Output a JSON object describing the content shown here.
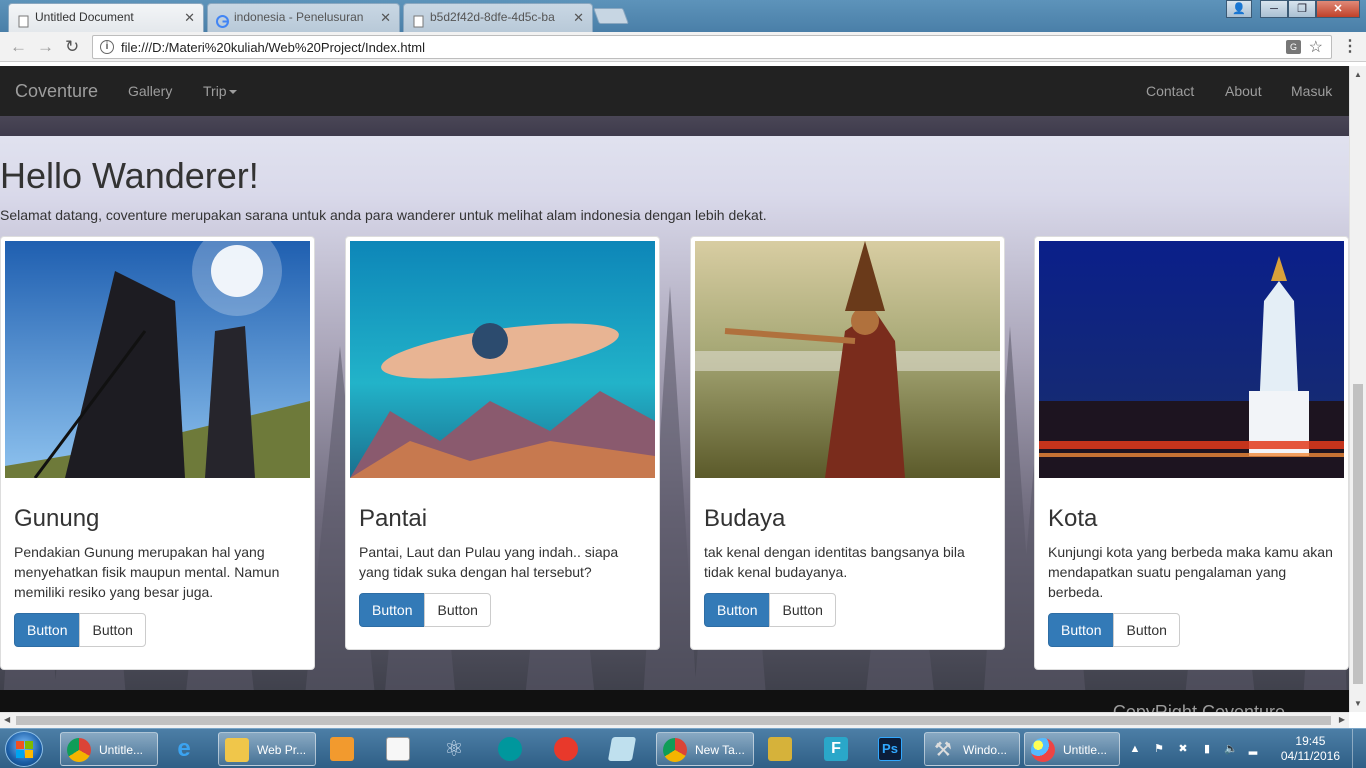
{
  "browser": {
    "tabs": [
      {
        "title": "Untitled Document",
        "active": true
      },
      {
        "title": "indonesia - Penelusuran",
        "active": false
      },
      {
        "title": "b5d2f42d-8dfe-4d5c-ba",
        "active": false
      }
    ],
    "url": "file:///D:/Materi%20kuliah/Web%20Project/Index.html"
  },
  "site": {
    "brand": "Coventure",
    "nav_left": [
      "Gallery",
      "Trip"
    ],
    "nav_right": [
      "Contact",
      "About",
      "Masuk"
    ],
    "hero_title": "Hello Wanderer!",
    "hero_text": "Selamat datang, coventure merupakan sarana untuk anda para wanderer untuk melihat alam indonesia dengan lebih dekat.",
    "cards": [
      {
        "title": "Gunung",
        "text": "Pendakian Gunung merupakan hal yang menyehatkan fisik maupun mental. Namun memiliki resiko yang besar juga.",
        "primary": "Button",
        "secondary": "Button"
      },
      {
        "title": "Pantai",
        "text": "Pantai, Laut dan Pulau yang indah.. siapa yang tidak suka dengan hal tersebut?",
        "primary": "Button",
        "secondary": "Button"
      },
      {
        "title": "Budaya",
        "text": "tak kenal dengan identitas bangsanya bila tidak kenal budayanya.",
        "primary": "Button",
        "secondary": "Button"
      },
      {
        "title": "Kota",
        "text": "Kunjungi kota yang berbeda maka kamu akan mendapatkan suatu pengalaman yang berbeda.",
        "primary": "Button",
        "secondary": "Button"
      }
    ],
    "footer": "CopyRight Coventure"
  },
  "taskbar": {
    "items": [
      {
        "label": "Untitle...",
        "icon": "chrome-icon"
      },
      {
        "label": "",
        "icon": "internet-explorer-icon"
      },
      {
        "label": "Web Pr...",
        "icon": "folder-icon"
      },
      {
        "label": "",
        "icon": "media-player-icon"
      },
      {
        "label": "",
        "icon": "notepad-icon"
      },
      {
        "label": "",
        "icon": "atom-icon"
      },
      {
        "label": "",
        "icon": "arduino-icon"
      },
      {
        "label": "",
        "icon": "app-red-icon"
      },
      {
        "label": "",
        "icon": "document-icon"
      },
      {
        "label": "New Ta...",
        "icon": "chrome-icon"
      },
      {
        "label": "",
        "icon": "app-tool-icon"
      },
      {
        "label": "",
        "icon": "f-app-icon"
      },
      {
        "label": "",
        "icon": "photoshop-icon"
      },
      {
        "label": "Windo...",
        "icon": "tools-icon"
      },
      {
        "label": "Untitle...",
        "icon": "paint-icon"
      }
    ],
    "time": "19:45",
    "date": "04/11/2016"
  }
}
